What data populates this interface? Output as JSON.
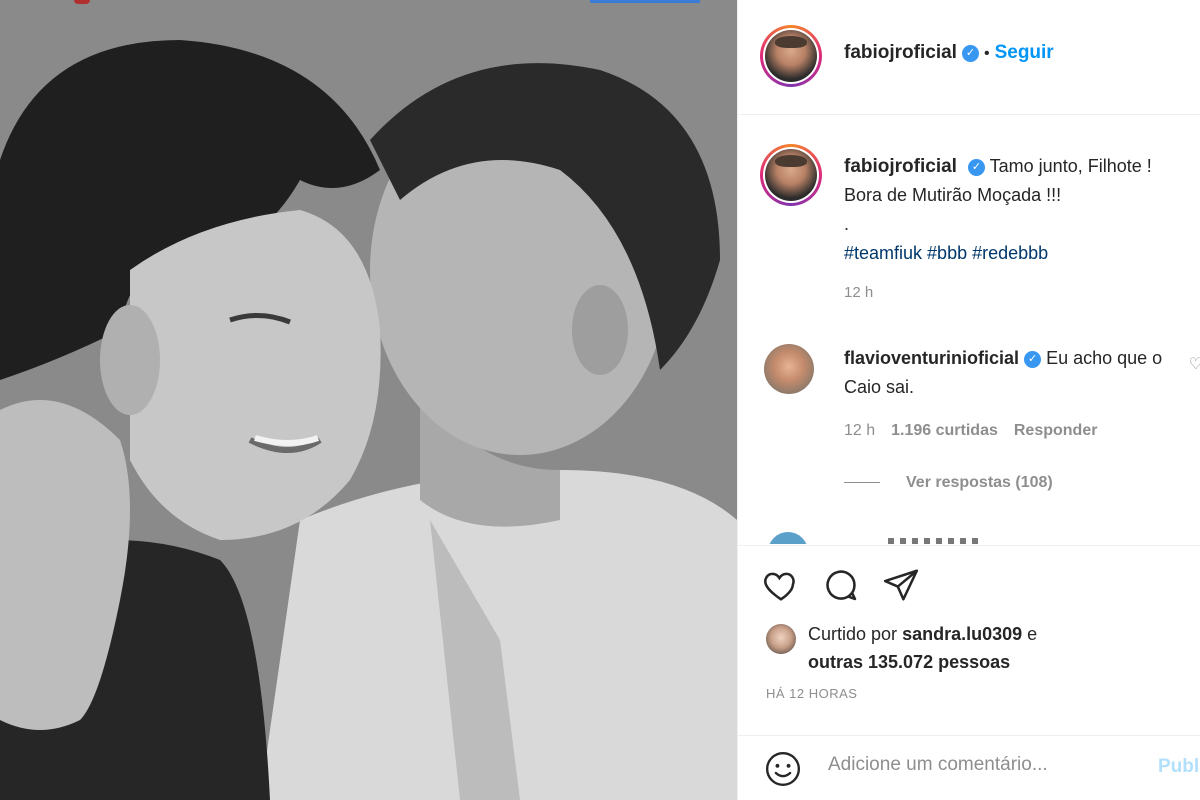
{
  "post": {
    "image_alt": "Black and white photo of two men embracing"
  },
  "header": {
    "username": "fabiojroficial",
    "separator": "•",
    "follow_label": "Seguir"
  },
  "caption": {
    "username": "fabiojroficial",
    "line1": "Tamo junto, Filhote !",
    "line2": "Bora de Mutirão Moçada !!!",
    "line3": ".",
    "hashtags": [
      "#teamfiuk",
      "#bbb",
      "#redebbb"
    ],
    "time": "12 h"
  },
  "comment": {
    "username": "flavioventurinioficial",
    "text": "Eu acho que o Caio sai.",
    "time": "12 h",
    "likes": "1.196 curtidas",
    "reply_label": "Responder",
    "view_replies": "Ver respostas (108)"
  },
  "actions": {
    "icons": [
      "heart-icon",
      "comment-icon",
      "share-icon"
    ]
  },
  "likes": {
    "prefix": "Curtido por",
    "user": "sandra.lu0309",
    "conj": "e",
    "others": "outras 135.072 pessoas"
  },
  "posted_ago": "HÁ 12 HORAS",
  "add_comment": {
    "placeholder": "Adicione um comentário...",
    "publish_label": "Publicar"
  }
}
